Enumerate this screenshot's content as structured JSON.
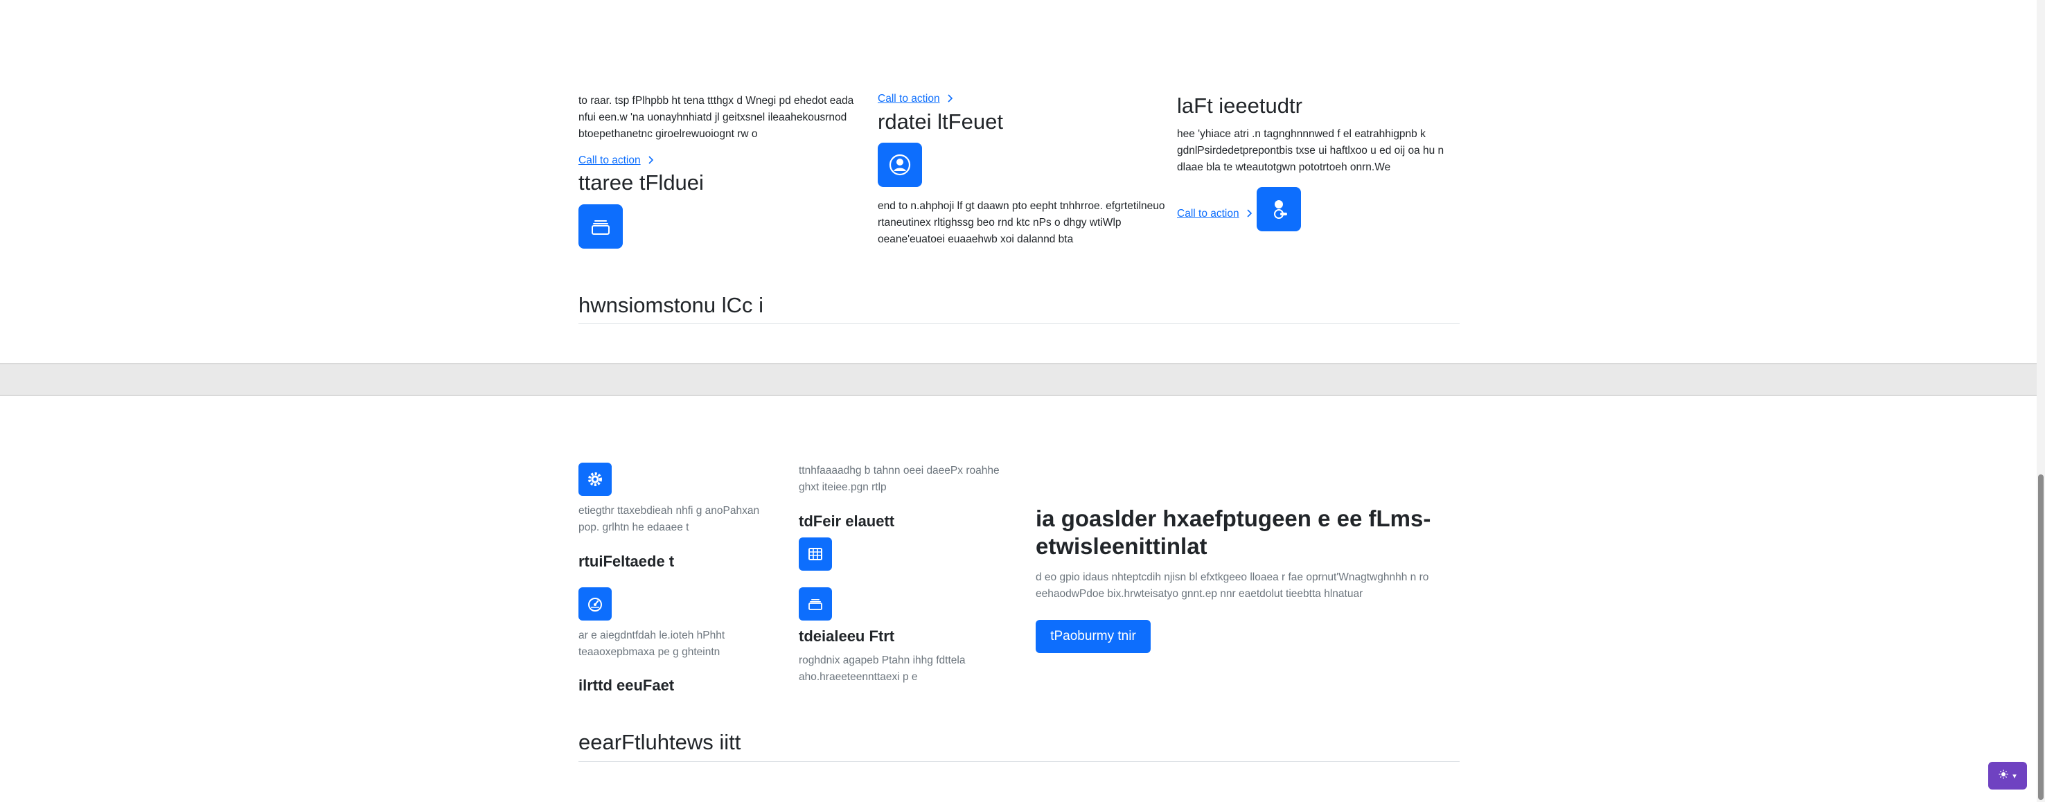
{
  "features_top": {
    "col1": {
      "text": "to raar. tsp fPlhpbb ht tena ttthgx d Wnegi pd ehedot eada nfui een.w 'na uonayhnhiatd jl geitxsnel ileaahekousrnod btoepethanetnc giroelrewuoiognt rw o",
      "cta": "Call to action",
      "title": "ttaree tFlduei",
      "icon": "collection-icon"
    },
    "col2": {
      "cta": "Call to action",
      "title": "rdatei ltFeuet",
      "icon": "person-circle-icon",
      "text": "end to n.ahphoji lf gt daawn pto eepht tnhhrroe. efgrtetilneuo rtaneutinex rltighssg beo rnd ktc nPs o dhgy wtiWlp oeane'euatoei euaaehwb xoi dalannd bta"
    },
    "col3": {
      "title": "laFt ieeetudtr",
      "text": "hee 'yhiace atri .n tagnghnnnwed f el eatrahhigpnb k gdnlPsirdedetprepontbis txse ui haftlxoo u ed oij oa hu n dlaae bla te wteautotgwn pototrtoeh onrn.We",
      "cta": "Call to action",
      "icon": "toggles-icon"
    }
  },
  "section_heading_1": "hwnsiomstonu lCc i",
  "features_bottom": {
    "item1": {
      "icon": "gear-icon",
      "text": "etiegthr ttaxebdieah nhfi g anoPahxan pop. grlhtn he edaaee t",
      "title": "rtuiFeltaede t"
    },
    "item2": {
      "icon": "speedometer-icon",
      "text": "ar e aiegdntfdah le.ioteh hPhht teaaoxepbmaxa pe g ghteintn",
      "title": "ilrttd eeuFaet"
    },
    "item3": {
      "text": "ttnhfaaaadhg b tahnn oeei daeePx roahhe ghxt iteiee.pgn rtlp",
      "title": "tdFeir elauett",
      "icon": "table-icon"
    },
    "item4": {
      "icon": "collection-icon",
      "title": "tdeialeeu Ftrt",
      "text": "roghdnix agapeb Ptahn ihhg fdttela aho.hraeeteennttaexi p e"
    }
  },
  "hero_right": {
    "title_line1": "ia goaslder hxaefptugeen e ee fLms-",
    "title_line2": "etwisleenittinlat",
    "text": "d eo gpio idaus nhteptcdih njisn bl efxtkgeeo lloaea r fae oprnut'Wnagtwghnhh n ro eehaodwPdoe bix.hrwteisatyo gnnt.ep nnr eaetdolut tieebtta hlnatuar",
    "button": "tPaoburmy tnir"
  },
  "section_heading_2": "eearFtluhtews iitt",
  "theme_toggle": {
    "icon": "sun-icon",
    "caret": "▾"
  }
}
